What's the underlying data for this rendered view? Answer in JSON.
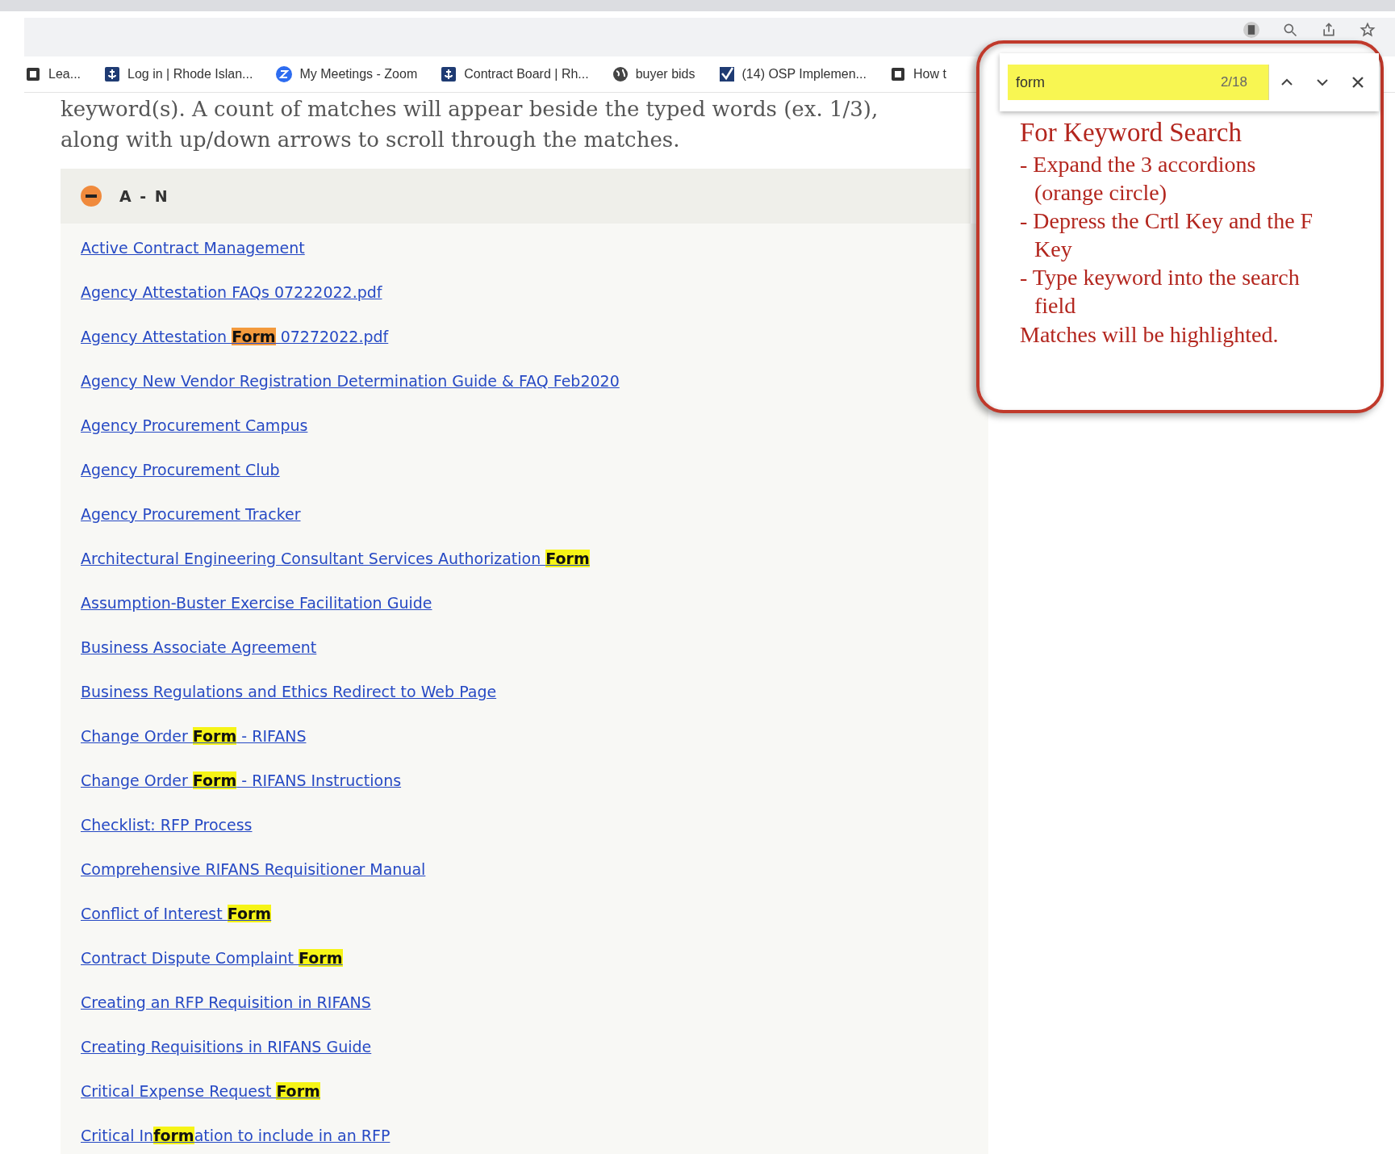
{
  "bookmarks": [
    {
      "label": "Lea..."
    },
    {
      "label": "Log in | Rhode Islan..."
    },
    {
      "label": "My Meetings - Zoom"
    },
    {
      "label": "Contract Board | Rh..."
    },
    {
      "label": "buyer bids"
    },
    {
      "label": "(14) OSP Implemen..."
    },
    {
      "label": "How t"
    }
  ],
  "intro": [
    "keyword(s). A count of matches will appear beside the typed words (ex. 1/3),",
    "along with up/down arrows to scroll through the matches."
  ],
  "accordion": {
    "title": "A - N",
    "expanded": true
  },
  "links": [
    [
      {
        "kind": "text",
        "text": "Active Contract Management"
      }
    ],
    [
      {
        "kind": "text",
        "text": "Agency Attestation FAQs 07222022.pdf"
      }
    ],
    [
      {
        "kind": "text",
        "text": "Agency Attestation "
      },
      {
        "kind": "current-match",
        "text": "Form"
      },
      {
        "kind": "text",
        "text": " 07272022.pdf"
      }
    ],
    [
      {
        "kind": "text",
        "text": "Agency New Vendor Registration Determination Guide & FAQ Feb2020"
      }
    ],
    [
      {
        "kind": "text",
        "text": "Agency Procurement Campus"
      }
    ],
    [
      {
        "kind": "text",
        "text": "Agency Procurement Club"
      }
    ],
    [
      {
        "kind": "text",
        "text": "Agency Procurement Tracker"
      }
    ],
    [
      {
        "kind": "text",
        "text": "Architectural Engineering Consultant Services Authorization "
      },
      {
        "kind": "match",
        "text": "Form"
      }
    ],
    [
      {
        "kind": "text",
        "text": "Assumption-Buster Exercise Facilitation Guide"
      }
    ],
    [
      {
        "kind": "text",
        "text": "Business Associate Agreement"
      }
    ],
    [
      {
        "kind": "text",
        "text": "Business Regulations and Ethics Redirect to Web Page"
      }
    ],
    [
      {
        "kind": "text",
        "text": "Change Order "
      },
      {
        "kind": "match",
        "text": "Form"
      },
      {
        "kind": "text",
        "text": " - RIFANS"
      }
    ],
    [
      {
        "kind": "text",
        "text": "Change Order "
      },
      {
        "kind": "match",
        "text": "Form"
      },
      {
        "kind": "text",
        "text": " - RIFANS Instructions"
      }
    ],
    [
      {
        "kind": "text",
        "text": "Checklist: RFP Process"
      }
    ],
    [
      {
        "kind": "text",
        "text": "Comprehensive RIFANS Requisitioner Manual"
      }
    ],
    [
      {
        "kind": "text",
        "text": "Conflict of Interest "
      },
      {
        "kind": "match",
        "text": "Form"
      }
    ],
    [
      {
        "kind": "text",
        "text": "Contract Dispute Complaint "
      },
      {
        "kind": "match",
        "text": "Form"
      }
    ],
    [
      {
        "kind": "text",
        "text": "Creating an RFP Requisition in RIFANS"
      }
    ],
    [
      {
        "kind": "text",
        "text": "Creating Requisitions in RIFANS Guide"
      }
    ],
    [
      {
        "kind": "text",
        "text": "Critical Expense Request "
      },
      {
        "kind": "match",
        "text": "Form"
      }
    ],
    [
      {
        "kind": "text",
        "text": "Critical In"
      },
      {
        "kind": "match",
        "text": "form"
      },
      {
        "kind": "text",
        "text": "ation to include in an RFP"
      }
    ]
  ],
  "find_bar": {
    "value": "form",
    "count": "2/18"
  },
  "callout": {
    "title": "For Keyword Search",
    "steps": [
      "- Expand the 3 accordions (orange circle)",
      "- Depress the Crtl Key and the F Key",
      "- Type keyword into the search field"
    ],
    "footer": "Matches will be highlighted."
  }
}
